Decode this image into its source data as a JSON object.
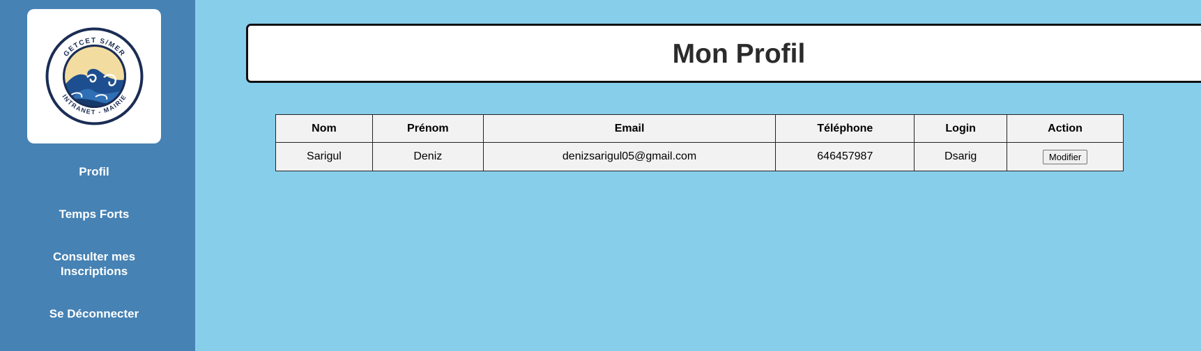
{
  "logo": {
    "top_text": "GETCET S/MER",
    "bottom_text": "INTRANET - MAIRIE"
  },
  "nav": {
    "profil": "Profil",
    "temps_forts": "Temps Forts",
    "inscriptions_line1": "Consulter mes",
    "inscriptions_line2": "Inscriptions",
    "logout": "Se Déconnecter"
  },
  "header": {
    "title": "Mon Profil"
  },
  "table": {
    "columns": [
      "Nom",
      "Prénom",
      "Email",
      "Téléphone",
      "Login",
      "Action"
    ],
    "rows": [
      {
        "nom": "Sarigul",
        "prenom": "Deniz",
        "email": "denizsarigul05@gmail.com",
        "telephone": "646457987",
        "login": "Dsarig",
        "action_label": "Modifier"
      }
    ]
  },
  "colors": {
    "background": "#87ceeb",
    "sidebar": "#4682b4",
    "table_bg": "#f2f2f2"
  }
}
